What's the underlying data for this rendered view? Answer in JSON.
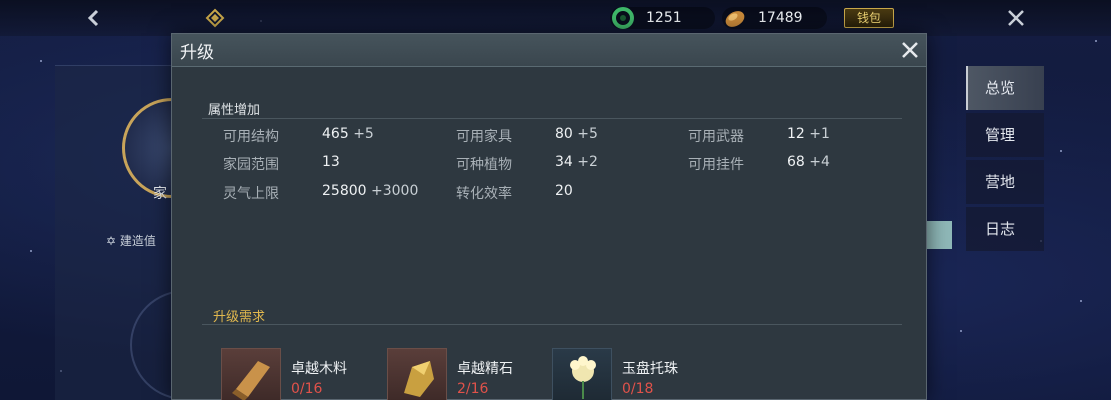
{
  "topbar": {
    "jade_amount": "1251",
    "gold_amount": "17489",
    "wallet_label": "钱包"
  },
  "background": {
    "emblem_label": "家",
    "build_label": "建造值"
  },
  "side_tabs": [
    {
      "label": "总览",
      "active": true
    },
    {
      "label": "管理",
      "active": false
    },
    {
      "label": "营地",
      "active": false
    },
    {
      "label": "日志",
      "active": false
    }
  ],
  "modal": {
    "title": "升级",
    "attributes_title": "属性增加",
    "attributes": [
      {
        "label": "可用结构",
        "value": "465",
        "increase": "+5"
      },
      {
        "label": "可用家具",
        "value": "80",
        "increase": "+5"
      },
      {
        "label": "可用武器",
        "value": "12",
        "increase": "+1"
      },
      {
        "label": "家园范围",
        "value": "13",
        "increase": ""
      },
      {
        "label": "可种植物",
        "value": "34",
        "increase": "+2"
      },
      {
        "label": "可用挂件",
        "value": "68",
        "increase": "+4"
      },
      {
        "label": "灵气上限",
        "value": "25800",
        "increase": "+3000"
      },
      {
        "label": "转化效率",
        "value": "20",
        "increase": ""
      }
    ],
    "requirements_title": "升级需求",
    "requirements": [
      {
        "name": "卓越木料",
        "count": "0/16",
        "icon": "wood-icon"
      },
      {
        "name": "卓越精石",
        "count": "2/16",
        "icon": "stone-icon"
      },
      {
        "name": "玉盘托珠",
        "count": "0/18",
        "icon": "flower-icon"
      }
    ]
  },
  "colors": {
    "accent_gold": "#e1b84e",
    "insufficient_red": "#e0524a",
    "modal_bg": "#2e3840"
  }
}
